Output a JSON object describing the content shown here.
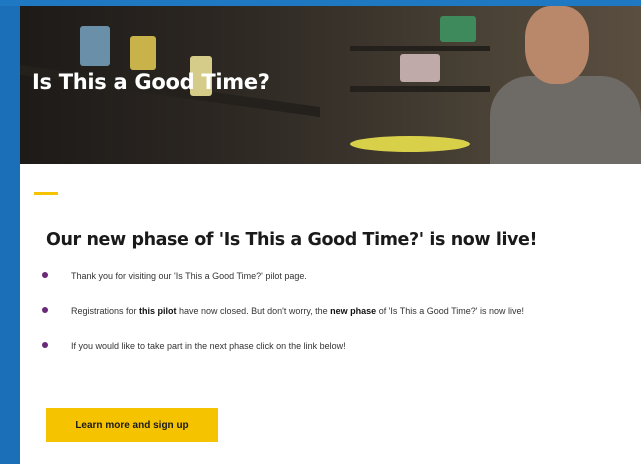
{
  "hero": {
    "title": "Is This a Good Time?"
  },
  "main": {
    "heading": "Our new phase of 'Is This a Good Time?' is now live!",
    "bullets": [
      {
        "text": "Thank you for visiting our 'Is This a Good Time?' pilot page."
      },
      {
        "pre": "Registrations for ",
        "bold1": "this pilot",
        "mid": " have now closed. But don't worry, the ",
        "bold2": "new phase",
        "post": " of 'Is This a Good Time?' is now live!"
      },
      {
        "text": "If you would like to take part in the next phase click on the link below!"
      }
    ],
    "cta_label": "Learn more and sign up"
  },
  "colors": {
    "frame": "#1a6fb8",
    "accent": "#f5c300",
    "bullet": "#6b2a78"
  }
}
